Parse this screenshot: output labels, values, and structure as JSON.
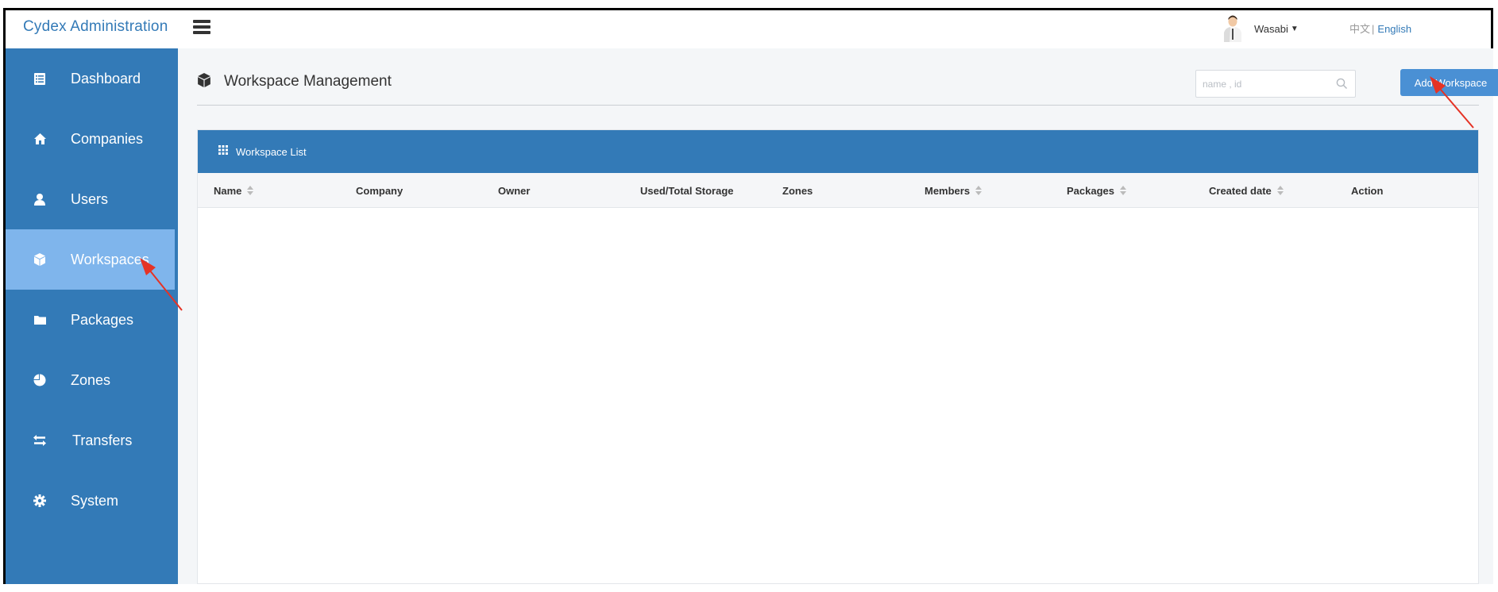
{
  "app": {
    "title": "Cydex  Administration"
  },
  "header": {
    "user_name": "Wasabi",
    "lang_zh": "中文",
    "lang_sep": "|",
    "lang_en": "English"
  },
  "sidebar": {
    "items": [
      {
        "label": "Dashboard",
        "icon": "list-icon",
        "active": false
      },
      {
        "label": "Companies",
        "icon": "home-icon",
        "active": false
      },
      {
        "label": "Users",
        "icon": "user-icon",
        "active": false
      },
      {
        "label": "Workspaces",
        "icon": "cube-icon",
        "active": true
      },
      {
        "label": "Packages",
        "icon": "folder-icon",
        "active": false
      },
      {
        "label": "Zones",
        "icon": "pie-chart-icon",
        "active": false
      },
      {
        "label": "Transfers",
        "icon": "transfer-icon",
        "active": false
      },
      {
        "label": "System",
        "icon": "gear-icon",
        "active": false
      }
    ]
  },
  "main": {
    "title": "Workspace Management",
    "search_placeholder": "name , id",
    "search_value": "",
    "add_button": "Add Workspace",
    "panel_title": "Workspace List",
    "columns": [
      {
        "label": "Name",
        "sortable": true
      },
      {
        "label": "Company",
        "sortable": false
      },
      {
        "label": "Owner",
        "sortable": false
      },
      {
        "label": "Used/Total Storage",
        "sortable": false
      },
      {
        "label": "Zones",
        "sortable": false
      },
      {
        "label": "Members",
        "sortable": true
      },
      {
        "label": "Packages",
        "sortable": true
      },
      {
        "label": "Created date",
        "sortable": true
      },
      {
        "label": "Action",
        "sortable": false
      }
    ],
    "rows": []
  },
  "colors": {
    "primary": "#337ab7",
    "sidebar_active": "#7fb5ec",
    "button": "#4a90d4",
    "annotation_arrow": "#e53325"
  }
}
